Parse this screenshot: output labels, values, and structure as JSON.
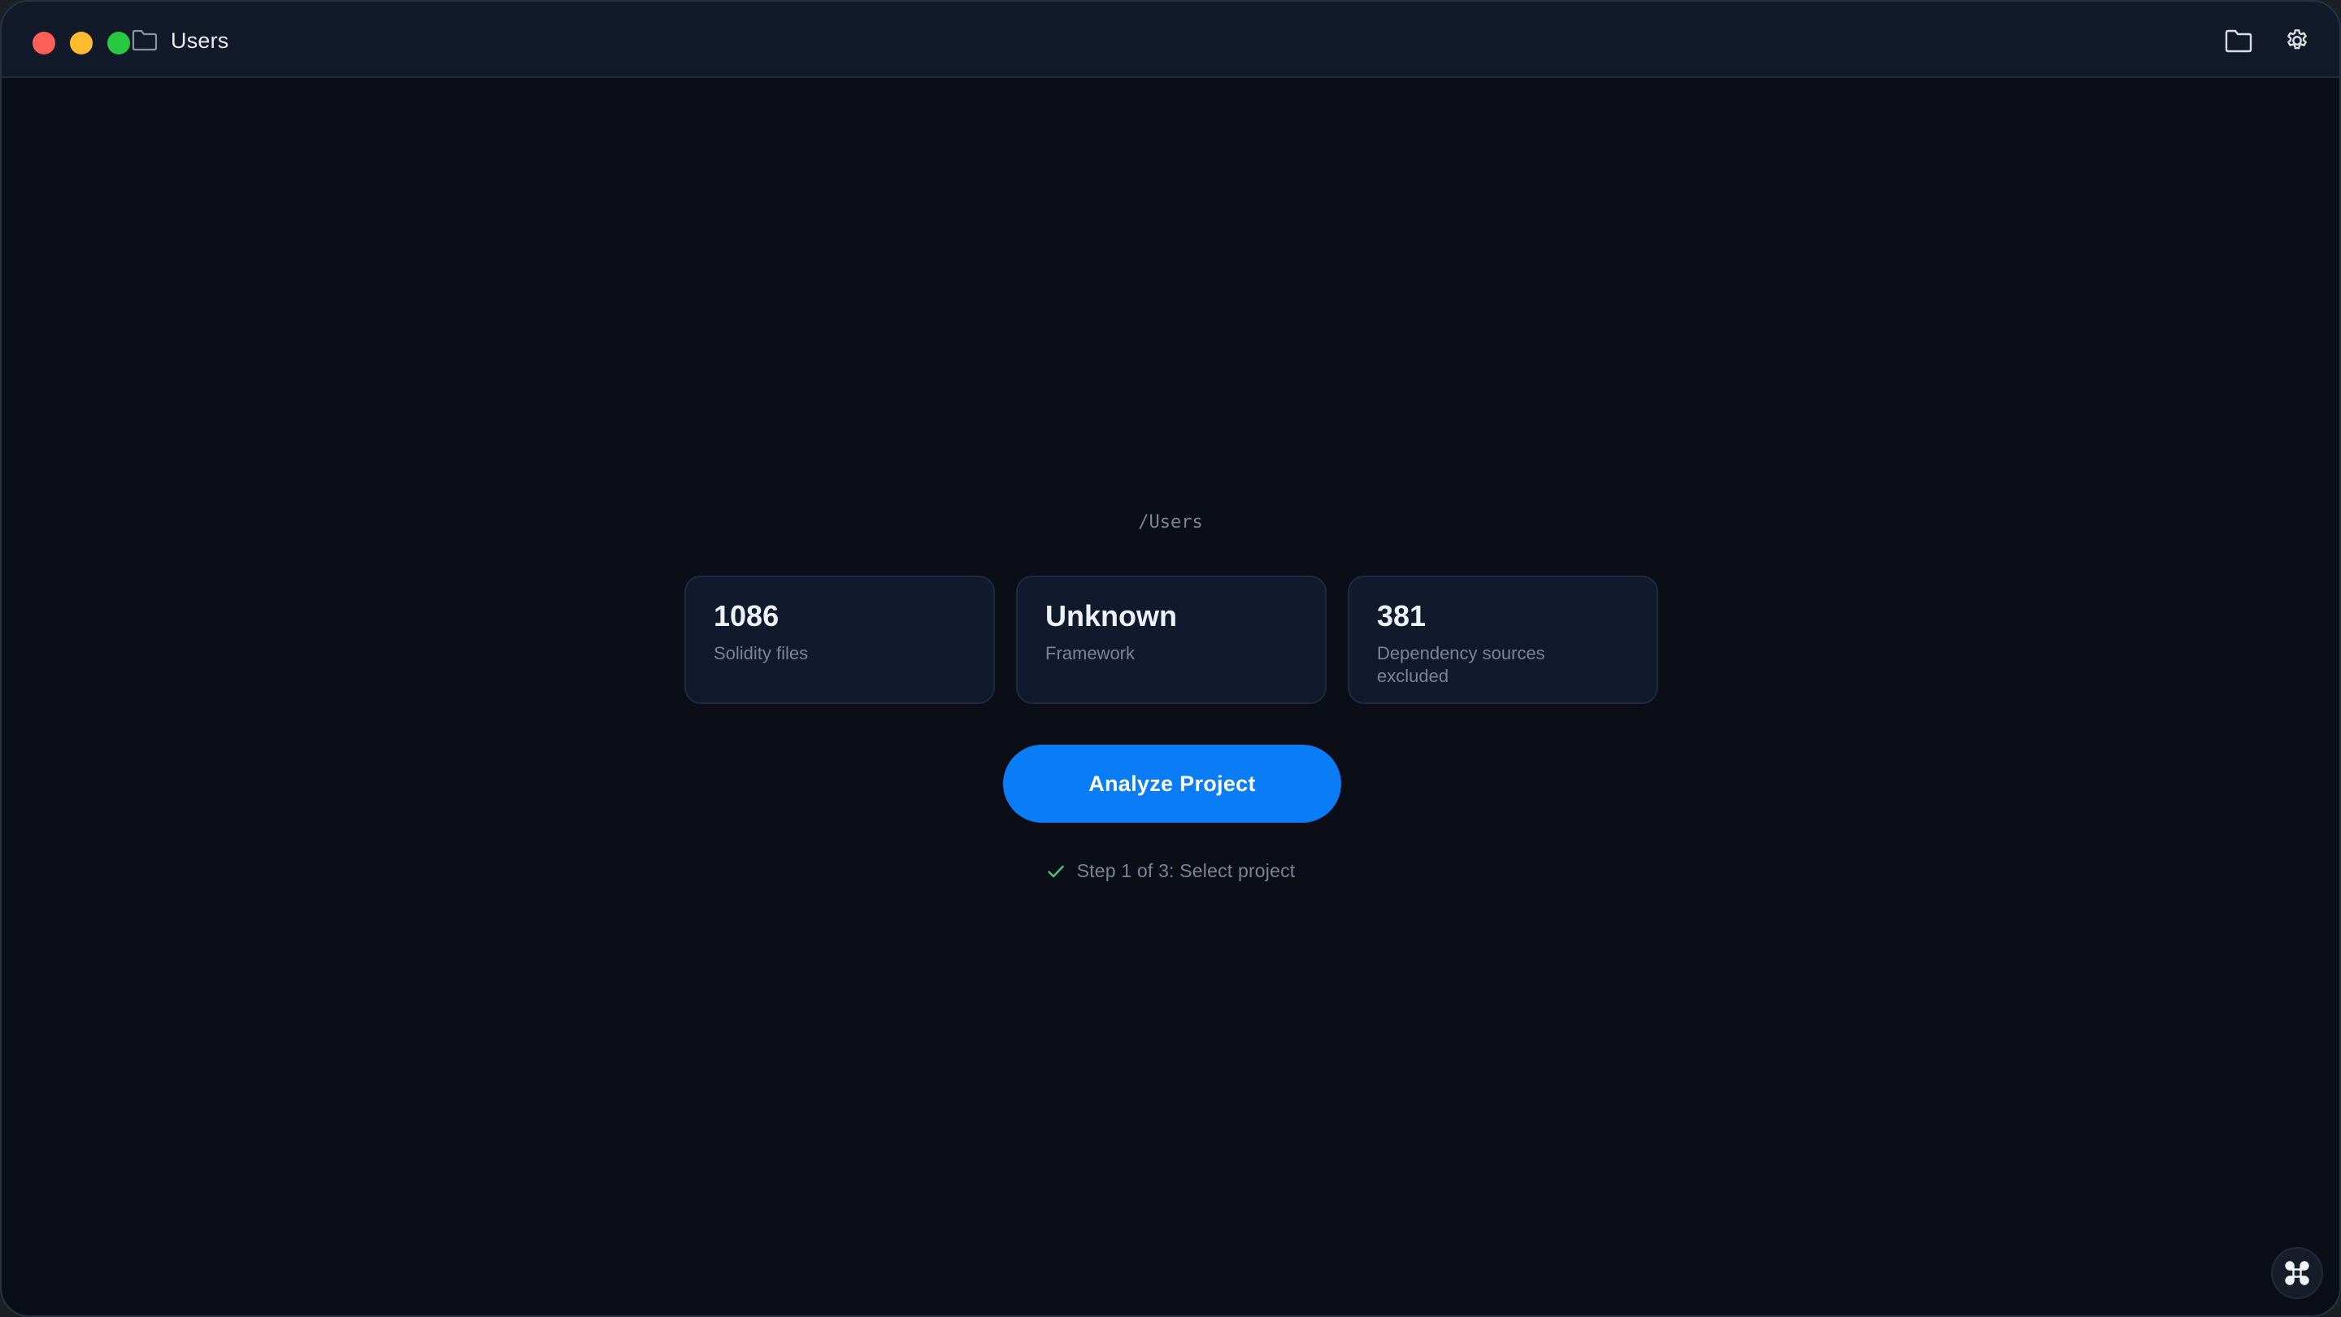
{
  "window": {
    "title": "Users",
    "traffic_lights": {
      "close_color": "#fe5f57",
      "minimize_color": "#febc2e",
      "maximize_color": "#28c840"
    },
    "title_icon": "folder-icon",
    "toolbar": {
      "open_folder_icon": "folder-icon",
      "settings_icon": "gear-icon"
    }
  },
  "main": {
    "path": "/Users",
    "stats": [
      {
        "value": "1086",
        "label": "Solidity files"
      },
      {
        "value": "Unknown",
        "label": "Framework"
      },
      {
        "value": "381",
        "label": "Dependency sources excluded"
      }
    ],
    "analyze_button": {
      "label": "Analyze Project",
      "color": "#0a7cf5"
    },
    "step": {
      "icon": "check-icon",
      "text": "Step 1 of 3: Select project",
      "check_color": "#4fb889"
    }
  },
  "corner_button": {
    "icon": "command-icon"
  },
  "colors": {
    "background": "#0b0e17",
    "titlebar": "#121a2a",
    "card": "#111a2c",
    "accent": "#0a7cf5"
  }
}
